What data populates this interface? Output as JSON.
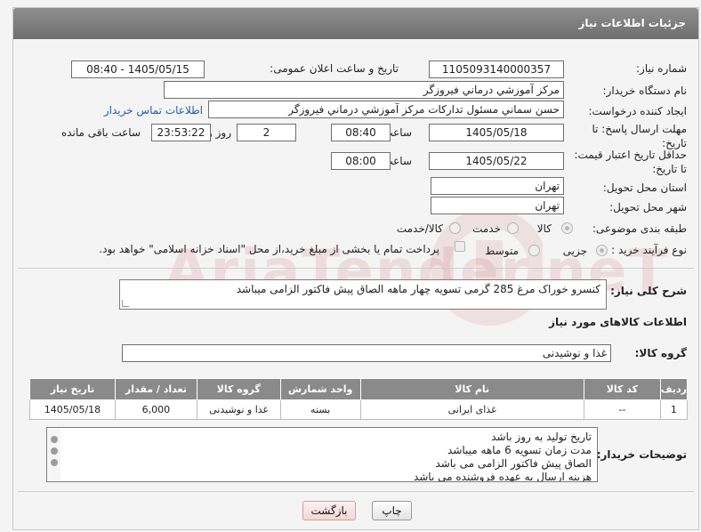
{
  "header": {
    "title": "جزئیات اطلاعات نیاز"
  },
  "form": {
    "need_number": {
      "label": "شماره نیاز:",
      "value": "1105093140000357"
    },
    "announce_datetime": {
      "label": "تاریخ و ساعت اعلان عمومی:",
      "value": "1405/05/15 - 08:40"
    },
    "buyer_org": {
      "label": "نام دستگاه خریدار:",
      "value": "مرکز آموزشي درماني فيروزگر"
    },
    "requester": {
      "label": "ایجاد کننده درخواست:",
      "value": "حسن سماني مسئول تداركات مرکز آموزشي درماني فيروزگر",
      "contact_link": "اطلاعات تماس خریدار"
    },
    "reply_deadline": {
      "label": "مهلت ارسال پاسخ: تا تاریخ:",
      "date": "1405/05/18",
      "time_label": "ساعت",
      "time": "08:40",
      "days": "2",
      "days_label": "روز و",
      "remaining": "23:53:22",
      "remaining_label": "ساعت باقی مانده"
    },
    "price_validity": {
      "label": "حداقل تاریخ اعتبار قیمت: تا تاریخ:",
      "date": "1405/05/22",
      "time_label": "ساعت",
      "time": "08:00"
    },
    "delivery_province": {
      "label": "استان محل تحویل:",
      "value": "تهران"
    },
    "delivery_city": {
      "label": "شهر محل تحویل:",
      "value": "تهران"
    },
    "category": {
      "label": "طبقه بندی موضوعی:",
      "options": [
        "کالا",
        "خدمت",
        "کالا/خدمت"
      ],
      "selected": "کالا"
    },
    "purchase_process": {
      "label": "نوع فرآیند خرید :",
      "options": [
        "جزیی",
        "متوسط"
      ],
      "selected": "جزیی",
      "payment_note": "پرداخت تمام یا بخشی از مبلغ خرید،از محل \"اسناد خزانه اسلامی\" خواهد بود."
    },
    "description": {
      "label": "شرح کلی نیاز:",
      "value": "کنسرو خوراک مرغ 285 گرمی تسویه چهار ماهه الصاق پیش فاکتور الزامی میباشد"
    }
  },
  "goods_section": {
    "title": "اطلاعات کالاهای مورد نیاز",
    "group_label": "گروه کالا:",
    "group_value": "غذا و نوشیدنی",
    "columns": [
      "ردیف",
      "کد کالا",
      "نام کالا",
      "واحد شمارش",
      "گروه کالا",
      "تعداد / مقدار",
      "تاریخ نیاز"
    ],
    "rows": [
      [
        "1",
        "--",
        "غذای ایرانی",
        "بسته",
        "غذا و نوشیدنی",
        "6,000",
        "1405/05/18"
      ]
    ]
  },
  "buyer_notes": {
    "label": "توضیحات خریدار:",
    "lines": [
      "تاریخ تولید به روز باشد",
      "مدت زمان تسویه 6 ماهه میباشد",
      "الصاق پیش فاکتور الزامی می باشد",
      "هزینه ارسال به عهده فروشنده می باشد"
    ]
  },
  "buttons": {
    "print": "چاپ",
    "back": "بازگشت"
  },
  "watermark": {
    "text": "AriaTender.neT"
  }
}
